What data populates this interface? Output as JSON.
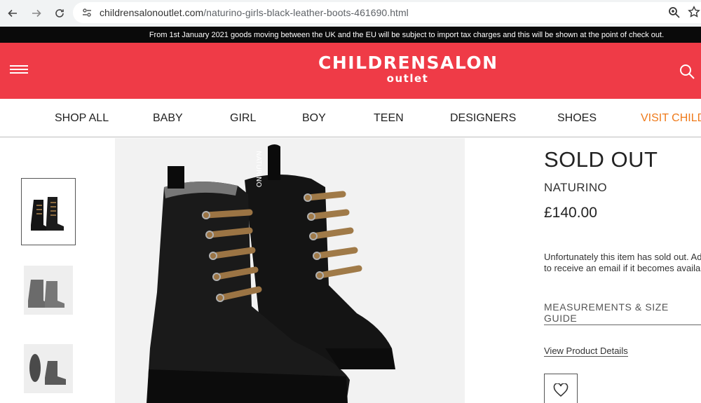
{
  "browser": {
    "url_host": "childrensalonoutlet.com",
    "url_path": "/naturino-girls-black-leather-boots-461690.html"
  },
  "notice": {
    "text": "From 1st January 2021 goods moving between the UK and the EU will be subject to import tax charges and this will be shown at the point of check out."
  },
  "header": {
    "logo_main": "CHILDRENSALON",
    "logo_sub": "outlet"
  },
  "nav": {
    "items": [
      "SHOP ALL",
      "BABY",
      "GIRL",
      "BOY",
      "TEEN",
      "DESIGNERS",
      "SHOES",
      "VISIT CHILD"
    ]
  },
  "product": {
    "status": "SOLD OUT",
    "brand": "NATURINO",
    "price": "£140.00",
    "sold_message_line1": "Unfortunately this item has sold out. Add",
    "sold_message_line2": "to receive an email if it becomes availabl",
    "size_guide": "MEASUREMENTS & SIZE GUIDE",
    "details_link": "View Product Details",
    "tab_label": "NATURINO"
  },
  "colors": {
    "brand_red": "#ef3b47",
    "accent_orange": "#ef7a1a",
    "notice_bg": "#0a0a0a"
  }
}
